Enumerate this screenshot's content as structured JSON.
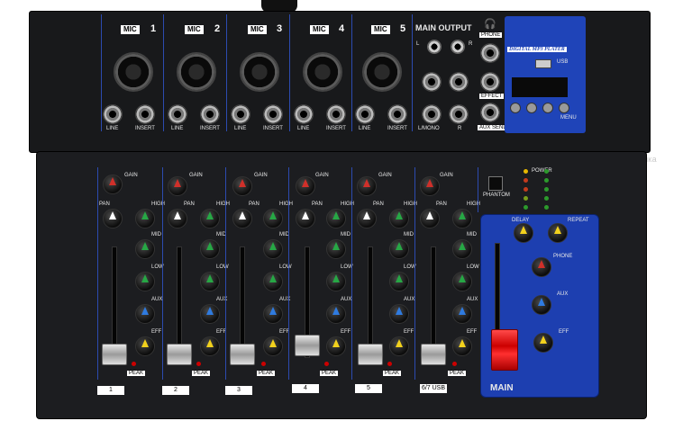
{
  "watermark": "Комиссионка",
  "top_panel": {
    "channels": [
      {
        "mic_label": "MIC",
        "num": "1",
        "line": "LINE",
        "insert": "INSERT"
      },
      {
        "mic_label": "MIC",
        "num": "2",
        "line": "LINE",
        "insert": "INSERT"
      },
      {
        "mic_label": "MIC",
        "num": "3",
        "line": "LINE",
        "insert": "INSERT"
      },
      {
        "mic_label": "MIC",
        "num": "4",
        "line": "LINE",
        "insert": "INSERT"
      },
      {
        "mic_label": "MIC",
        "num": "5",
        "line": "LINE",
        "insert": "INSERT"
      }
    ],
    "main_output": "MAIN OUTPUT",
    "l": "L",
    "r": "R",
    "lmono": "L/MONO",
    "phone": "PHONE",
    "effect": "EFFECT",
    "aux_send": "AUX SEND",
    "mp3_title": "DIGITAL MP3 PLATER",
    "usb": "USB",
    "menu": "MENU"
  },
  "front_panel": {
    "gain": "GAIN",
    "pan": "PAN",
    "high": "HIGH",
    "mid": "MID",
    "low": "LOW",
    "aux": "AUX",
    "eff": "EFF",
    "peak": "PEAK",
    "phantom": "PHANTOM",
    "power": "POWER",
    "channel_numbers": [
      "1",
      "2",
      "3",
      "4",
      "5",
      "6/7 USB"
    ],
    "main": "MAIN",
    "master": {
      "delay": "DELAY",
      "repeat": "REPEAT",
      "phone": "PHONE",
      "aux": "AUX",
      "eff": "EFF"
    }
  },
  "colors": {
    "panel": "#1c1d20",
    "blue": "#1d3fb0",
    "knob_red": "#d0302a",
    "knob_green": "#27a745",
    "knob_blue": "#2f7be0",
    "knob_yellow": "#f2d11d"
  }
}
